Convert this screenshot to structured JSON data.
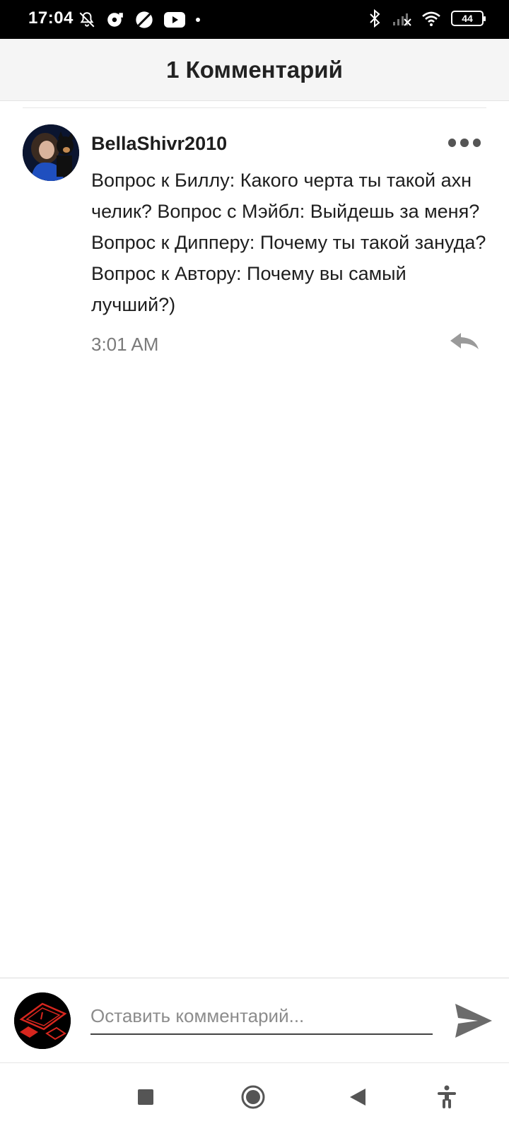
{
  "status_bar": {
    "time": "17:04",
    "icons_left": [
      "bell-off-icon",
      "sim-disk-icon",
      "no-sign-icon",
      "youtube-icon",
      "dot-icon"
    ],
    "icons_right": [
      "bluetooth-icon",
      "signal-icon",
      "wifi-icon",
      "battery-icon"
    ],
    "battery_level": "44"
  },
  "header": {
    "title": "1 Комментарий"
  },
  "comments": [
    {
      "author": "BellaShivr2010",
      "text": "Вопрос к Биллу: Какого черта ты такой ахн челик? Вопрос с Мэйбл: Выйдешь за меня? Вопрос к Дипперу: Почему ты такой зануда? Вопрос к Автору: Почему вы самый лучший?)",
      "time": "3:01 AM",
      "more_icon": "more-dots-icon",
      "reply_icon": "reply-icon"
    }
  ],
  "composer": {
    "placeholder": "Оставить комментарий...",
    "value": "",
    "send_icon": "send-icon"
  },
  "nav_bar": {
    "buttons": [
      "recents-square-icon",
      "home-circle-icon",
      "back-triangle-icon",
      "accessibility-icon"
    ]
  },
  "colors": {
    "status_bar_bg": "#000000",
    "header_bg": "#f5f5f5",
    "text_primary": "#1e1e1e",
    "text_secondary": "#7a7a7a",
    "icon_gray": "#555555"
  }
}
